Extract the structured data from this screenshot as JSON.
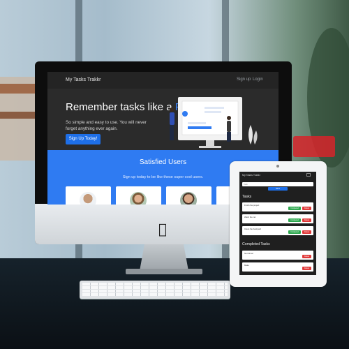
{
  "desktop_app": {
    "brand": "My Tasks Trakkr",
    "nav": {
      "signup": "Sign up",
      "login": "Login"
    },
    "hero": {
      "title_prefix": "Remember tasks like a ",
      "title_accent": "Pro",
      "subtitle": "So simple and easy to use. You will never forget anything ever again.",
      "cta": "Sign Up Today!"
    },
    "testimonials": {
      "title": "Satisfied Users",
      "subtitle": "Sign up today to be like these super cool users."
    }
  },
  "tablet_app": {
    "brand": "My Tasks Trakkr",
    "input_placeholder": "Task",
    "save_label": "Save",
    "tasks_heading": "Tasks",
    "tasks": [
      {
        "text": "Finish the project",
        "complete": "Completed",
        "delete": "Delete"
      },
      {
        "text": "Wash the car",
        "complete": "Completed",
        "delete": "Delete"
      },
      {
        "text": "Clean the backyard",
        "complete": "Completed",
        "delete": "Delete"
      }
    ],
    "completed_heading": "Completed Tasks",
    "completed": [
      {
        "text": "Get dinner",
        "delete": "Delete"
      },
      {
        "text": "Make",
        "delete": "Delete"
      }
    ]
  },
  "colors": {
    "accent": "#2f7bf2",
    "success": "#2ea84f",
    "danger": "#e03a3a",
    "screen_bg": "#2b2b2b"
  }
}
